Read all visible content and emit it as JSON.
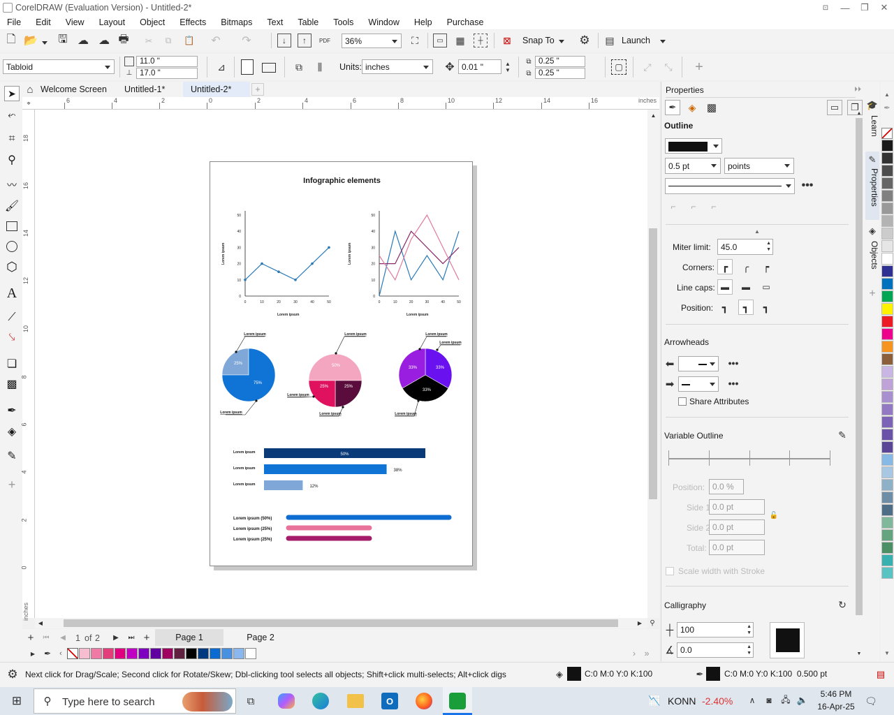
{
  "app": {
    "title": "CorelDRAW (Evaluation Version) - Untitled-2*"
  },
  "menu": [
    "File",
    "Edit",
    "View",
    "Layout",
    "Object",
    "Effects",
    "Bitmaps",
    "Text",
    "Table",
    "Tools",
    "Window",
    "Help",
    "Purchase"
  ],
  "toolbar": {
    "zoom": "36%",
    "snap_to": "Snap To",
    "launch": "Launch"
  },
  "propertybar": {
    "page_size": "Tabloid",
    "width": "11.0 \"",
    "height": "17.0 \"",
    "units_label": "Units:",
    "units": "inches",
    "nudge": "0.01 \"",
    "dup_x": "0.25 \"",
    "dup_y": "0.25 \""
  },
  "tabs": [
    "Welcome Screen",
    "Untitled-1*",
    "Untitled-2*"
  ],
  "rulers": {
    "h_ticks": [
      "6",
      "4",
      "2",
      "0",
      "2",
      "4",
      "6",
      "8",
      "10",
      "12",
      "14",
      "16"
    ],
    "v_ticks": [
      "18",
      "16",
      "14",
      "12",
      "10",
      "8",
      "6",
      "4",
      "2",
      "0"
    ],
    "unit": "inches"
  },
  "document": {
    "title": "Infographic elements",
    "axis_label": "Lorem ipsum",
    "small_label": "Lorem ipsum",
    "y_ticks": [
      "50",
      "40",
      "30",
      "20",
      "10",
      "0"
    ],
    "x_ticks": [
      "0",
      "10",
      "20",
      "30",
      "40",
      "50"
    ],
    "pie1": {
      "a": "25%",
      "b": "75%"
    },
    "pie2": {
      "a": "50%",
      "b": "25%",
      "c": "25%"
    },
    "pie3": {
      "a": "33%",
      "b": "33%",
      "c": "33%"
    },
    "bars": [
      {
        "label": "Lorem ipsum",
        "value": 50,
        "text": "50%",
        "color": "#0a3a78"
      },
      {
        "label": "Lorem ipsum",
        "value": 38,
        "text": "38%",
        "color": "#0f74d6"
      },
      {
        "label": "Lorem ipsum",
        "value": 12,
        "text": "12%",
        "color": "#7fa8d8"
      }
    ],
    "progress": [
      {
        "label": "Lorem ipsum (50%)",
        "value": 50,
        "color": "#0f6cd0"
      },
      {
        "label": "Lorem ipsum (25%)",
        "value": 25,
        "color": "#e9729b"
      },
      {
        "label": "Lorem ipsum (25%)",
        "value": 25,
        "color": "#a51c6b"
      }
    ]
  },
  "chart_data": [
    {
      "type": "line",
      "x": [
        0,
        10,
        20,
        30,
        40,
        50
      ],
      "series": [
        {
          "values": [
            10,
            20,
            15,
            10,
            20,
            30
          ]
        }
      ],
      "xlabel": "Lorem ipsum",
      "ylabel": "Lorem ipsum",
      "ylim": [
        0,
        50
      ],
      "xlim": [
        0,
        50
      ]
    },
    {
      "type": "line",
      "x": [
        0,
        10,
        20,
        30,
        40,
        50
      ],
      "series": [
        {
          "values": [
            0,
            40,
            10,
            25,
            10,
            40
          ]
        },
        {
          "values": [
            20,
            20,
            40,
            30,
            20,
            30
          ]
        },
        {
          "values": [
            25,
            10,
            35,
            50,
            30,
            10
          ]
        }
      ],
      "xlabel": "Lorem ipsum",
      "ylabel": "Lorem ipsum",
      "ylim": [
        0,
        50
      ],
      "xlim": [
        0,
        50
      ]
    },
    {
      "type": "pie",
      "values": [
        25,
        75
      ]
    },
    {
      "type": "pie",
      "values": [
        50,
        25,
        25
      ]
    },
    {
      "type": "pie",
      "values": [
        33,
        33,
        33
      ]
    }
  ],
  "pagenav": {
    "current": "1",
    "of": "of",
    "total": "2",
    "pages": [
      "Page 1",
      "Page 2"
    ]
  },
  "panel": {
    "title": "Properties",
    "outline_label": "Outline",
    "width": "0.5 pt",
    "units": "points",
    "miter_label": "Miter limit:",
    "miter": "45.0",
    "corners_label": "Corners:",
    "linecaps_label": "Line caps:",
    "position_label": "Position:",
    "arrowheads_label": "Arrowheads",
    "share_label": "Share Attributes",
    "variable_label": "Variable Outline",
    "vpos_label": "Position:",
    "vpos": "0.0 %",
    "side1_label": "Side 1:",
    "side1": "0.0 pt",
    "side2_label": "Side 2:",
    "side2": "0.0 pt",
    "total_label": "Total:",
    "total": "0.0 pt",
    "scale_label": "Scale width with Stroke",
    "calligraphy_label": "Calligraphy",
    "stretch": "100",
    "angle": "0.0"
  },
  "sidetabs": [
    "Learn",
    "Properties",
    "Objects"
  ],
  "palette_colors": [
    "#1a1a1a",
    "#333333",
    "#4d4d4d",
    "#666666",
    "#808080",
    "#999999",
    "#b3b3b3",
    "#cccccc",
    "#e6e6e6",
    "#ffffff",
    "#2e3192",
    "#0071bc",
    "#00a651",
    "#fff200",
    "#ed1c24",
    "#ec008c",
    "#f7941d",
    "#8b5e3c",
    "#c9b6e4",
    "#bfa2d8",
    "#a890d0",
    "#9378c4",
    "#7d63b8",
    "#6a52a8",
    "#5a4596",
    "#86b9e6",
    "#a8c7e2",
    "#8fb1c8",
    "#6d8ea6",
    "#4e6d86",
    "#7fb89a",
    "#64a47e",
    "#4b9065",
    "#37b0b0",
    "#59c3c3"
  ],
  "doc_palette": [
    "#f6bcd0",
    "#ef7aa6",
    "#e23e7c",
    "#e00080",
    "#c000c0",
    "#8000c0",
    "#6000a0",
    "#a00060",
    "#602040",
    "#000000",
    "#003880",
    "#0a6cd0",
    "#4a90e0",
    "#8ab8ee",
    "#ffffff"
  ],
  "status": {
    "hint": "Next click for Drag/Scale; Second click for Rotate/Skew; Dbl-clicking tool selects all objects; Shift+click multi-selects; Alt+click digs",
    "fill": "C:0 M:0 Y:0 K:100",
    "outline": "C:0 M:0 Y:0 K:100  0.500 pt"
  },
  "taskbar": {
    "search": "Type here to search",
    "stock_name": "KONN",
    "stock_change": "-2.40%",
    "time": "5:46 PM",
    "date": "16-Apr-25"
  }
}
